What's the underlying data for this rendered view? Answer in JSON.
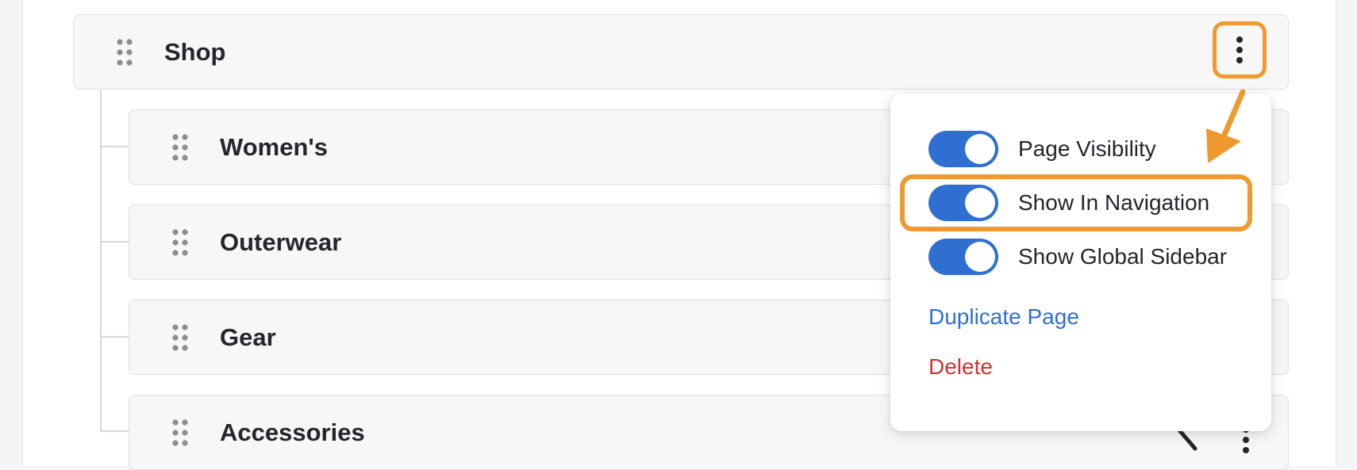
{
  "tree": {
    "parent": {
      "label": "Shop",
      "menu_icon": "kebab-menu-icon",
      "drag_icon": "drag-handle-icon"
    },
    "children": [
      {
        "label": "Women's"
      },
      {
        "label": "Outerwear"
      },
      {
        "label": "Gear"
      },
      {
        "label": "Accessories"
      }
    ]
  },
  "menu": {
    "toggles": [
      {
        "label": "Page Visibility",
        "on": true
      },
      {
        "label": "Show In Navigation",
        "on": true
      },
      {
        "label": "Show Global Sidebar",
        "on": true
      }
    ],
    "duplicate_label": "Duplicate Page",
    "delete_label": "Delete"
  },
  "colors": {
    "accent_blue": "#2f6fd1",
    "danger_red": "#d0312d",
    "annotation_orange": "#f0992e"
  }
}
